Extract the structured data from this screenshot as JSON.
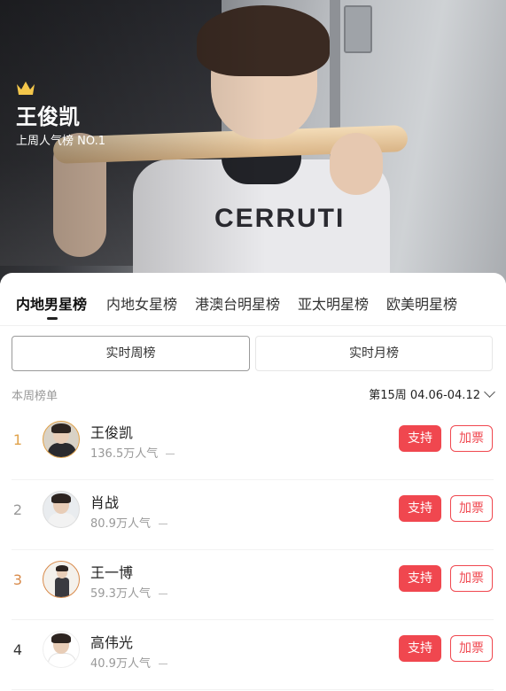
{
  "hero": {
    "name": "王俊凯",
    "subtitle": "上周人气榜 NO.1",
    "shirt_text": "CERRUTI",
    "crown_color": "#f3c64b"
  },
  "tabs": [
    {
      "label": "内地男星榜",
      "active": true
    },
    {
      "label": "内地女星榜",
      "active": false
    },
    {
      "label": "港澳台明星榜",
      "active": false
    },
    {
      "label": "亚太明星榜",
      "active": false
    },
    {
      "label": "欧美明星榜",
      "active": false
    }
  ],
  "segments": [
    {
      "label": "实时周榜",
      "active": true
    },
    {
      "label": "实时月榜",
      "active": false
    }
  ],
  "list_header": {
    "label": "本周榜单",
    "week_selector": "第15周 04.06-04.12"
  },
  "rankings": [
    {
      "rank": "1",
      "name": "王俊凯",
      "popularity": "136.5万人气",
      "rank_color": "#e0a24a",
      "support_label": "支持",
      "vote_label": "加票"
    },
    {
      "rank": "2",
      "name": "肖战",
      "popularity": "80.9万人气",
      "rank_color": "#999999",
      "support_label": "支持",
      "vote_label": "加票"
    },
    {
      "rank": "3",
      "name": "王一博",
      "popularity": "59.3万人气",
      "rank_color": "#d88a4a",
      "support_label": "支持",
      "vote_label": "加票"
    },
    {
      "rank": "4",
      "name": "高伟光",
      "popularity": "40.9万人气",
      "rank_color": "#333333",
      "support_label": "支持",
      "vote_label": "加票"
    }
  ],
  "colors": {
    "accent": "#f0474f"
  }
}
